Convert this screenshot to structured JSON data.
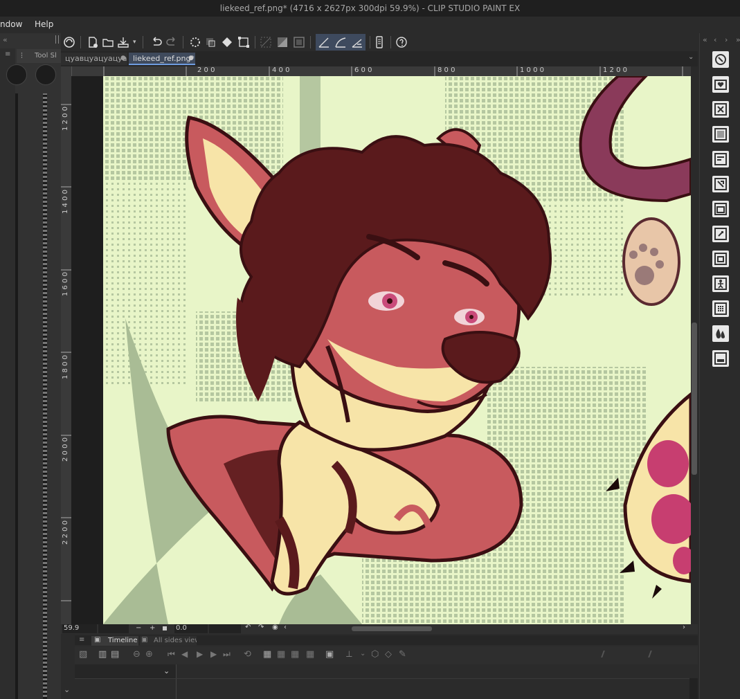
{
  "window": {
    "title": "liekeed_ref.png* (4716 x 2627px 300dpi 59.9%)  - CLIP STUDIO PAINT EX"
  },
  "menu": {
    "items": [
      "ndow",
      "Help"
    ]
  },
  "tool_panel": {
    "tab_label": "Tool Sl"
  },
  "tabs": [
    {
      "label": "цуавцуацуацуа"
    },
    {
      "label": "liekeed_ref.png*"
    }
  ],
  "rulers": {
    "horizontal": [
      "2 0 0",
      "4 0 0",
      "6 0 0",
      "8 0 0",
      "1 0 0 0",
      "1 2 0 0"
    ],
    "vertical": [
      "1 2 0 0",
      "1 4 0 0",
      "1 6 0 0",
      "1 8 0 0",
      "2 0 0 0",
      "2 2 0 0"
    ]
  },
  "status": {
    "zoom": "59.9",
    "rotation": "0.0",
    "minus": "−",
    "plus": "+"
  },
  "timeline": {
    "tab_label": "Timeline",
    "tab2_label": "All sides view"
  },
  "colors": {
    "background": "#e8f5c8",
    "dots": "#b5c7a0",
    "fur_red": "#c85a5e",
    "hair": "#5a1a1c",
    "cream": "#f7e4a8",
    "collar": "#8a3a5a",
    "outline": "#3a0f12"
  },
  "icons": {
    "command_bar": [
      "clip-studio-icon",
      "new-file-icon",
      "open-file-icon",
      "save-icon",
      "undo-icon",
      "redo-icon",
      "clear-icon",
      "crop-icon",
      "fill-icon",
      "transform-icon",
      "deselect-icon",
      "invert-selection-icon",
      "show-area-icon",
      "snap-ruler-icon",
      "snap-special-ruler-icon",
      "snap-grid-icon",
      "phone-icon",
      "help-icon"
    ],
    "right_bar": [
      "navigator-icon",
      "material-icon",
      "close-icon",
      "layer-property-icon",
      "layer-search-icon",
      "animation-cels-icon",
      "layer-icon",
      "history-icon",
      "sub-view-icon",
      "artist-pose-icon",
      "color-set-icon",
      "color-mixing-icon",
      "item-bank-icon"
    ]
  }
}
